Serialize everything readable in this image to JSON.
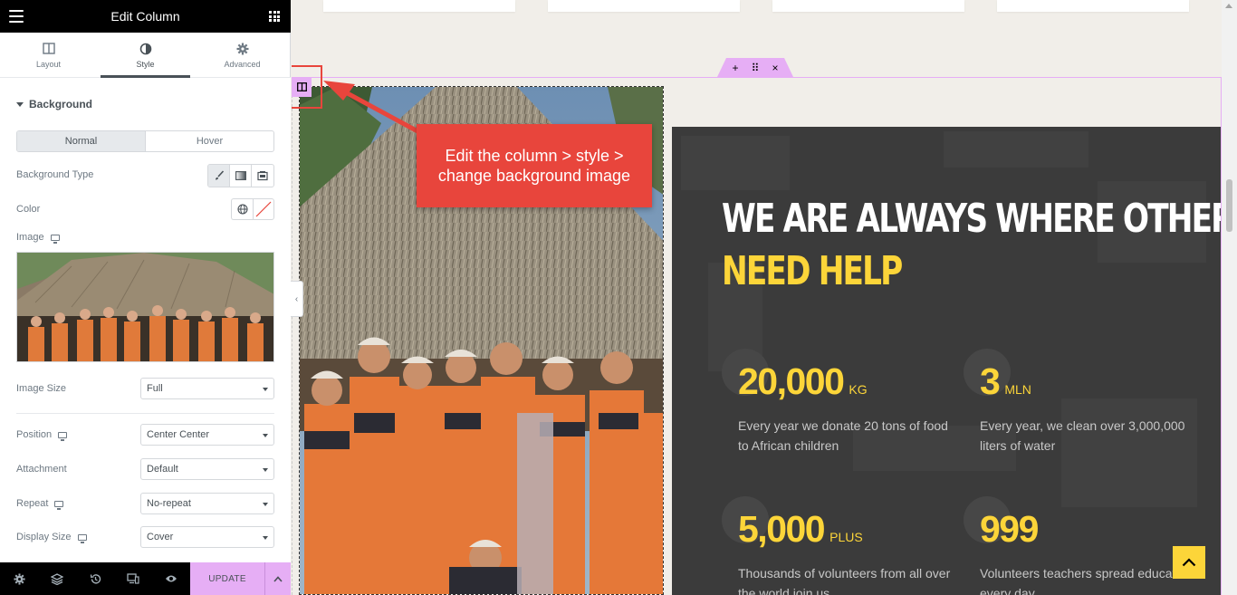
{
  "panel": {
    "title": "Edit Column",
    "tabs": [
      {
        "label": "Layout",
        "icon": "columns-icon"
      },
      {
        "label": "Style",
        "icon": "contrast-icon"
      },
      {
        "label": "Advanced",
        "icon": "gear-icon"
      }
    ],
    "active_tab": "Style",
    "section": "Background",
    "state_tabs": [
      "Normal",
      "Hover"
    ],
    "labels": {
      "background_type": "Background Type",
      "color": "Color",
      "image": "Image",
      "image_size": "Image Size",
      "position": "Position",
      "attachment": "Attachment",
      "repeat": "Repeat",
      "display_size": "Display Size"
    },
    "values": {
      "image_size": "Full",
      "position": "Center Center",
      "attachment": "Default",
      "repeat": "No-repeat",
      "display_size": "Cover"
    },
    "footer": {
      "update_label": "UPDATE",
      "icons": [
        "gear-icon",
        "layers-icon",
        "history-icon",
        "responsive-icon",
        "eye-icon"
      ]
    }
  },
  "preview": {
    "section_handle": [
      "+",
      "⠿",
      "×"
    ],
    "callout": {
      "line1": "Edit the column > style >",
      "line2": "change background image"
    },
    "headline_line1": "WE ARE ALWAYS WHERE OTHERS",
    "headline_line2": "NEED HELP",
    "stats": [
      {
        "number": "20,000",
        "unit": "KG",
        "desc": "Every year we donate 20 tons of food to African children"
      },
      {
        "number": "3",
        "unit": "MLN",
        "desc": "Every year, we clean over 3,000,000 liters of water"
      },
      {
        "number": "5,000",
        "unit": "PLUS",
        "desc": "Thousands of volunteers from all over the world join us"
      },
      {
        "number": "999",
        "unit": "",
        "desc": "Volunteers teachers spread education every day"
      }
    ],
    "colors": {
      "accent": "#fcd539",
      "editor_pink": "#e6aef5",
      "callout_red": "#e8453c",
      "dark_bg": "#3b3b3b"
    }
  }
}
